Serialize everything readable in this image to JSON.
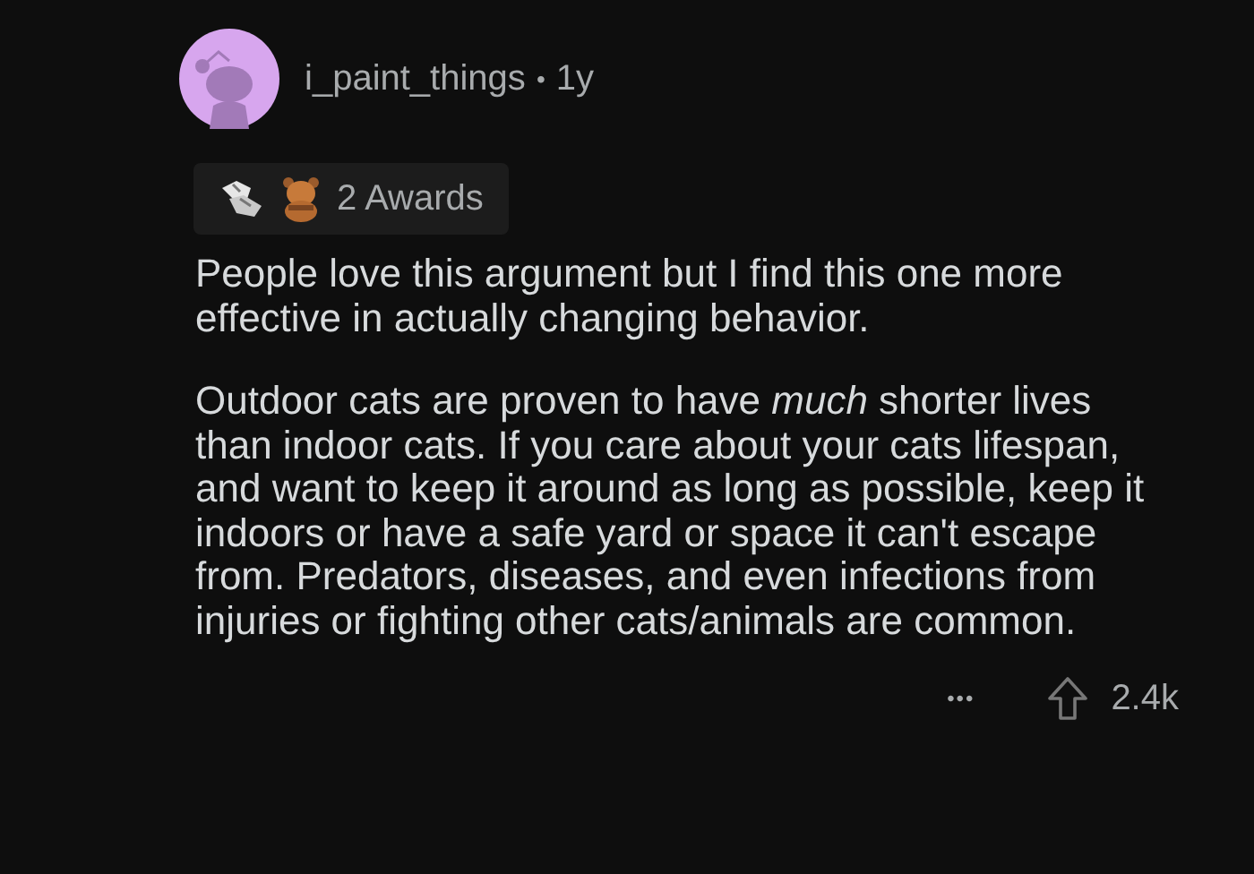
{
  "comment": {
    "author": "i_paint_things",
    "separator": "•",
    "age": "1y",
    "awards": {
      "label": "2 Awards"
    },
    "paragraphs": [
      "People love this argument but I find this one more effective in actually changing behavior.",
      "Outdoor cats are proven to have *much* shorter lives than indoor cats. If you care about your cats lifespan, and want to keep it around as long as possible, keep it indoors or have a safe yard or space it can't escape from. Predators, diseases, and even infections from injuries or fighting other cats/animals are common."
    ],
    "more": "•••",
    "score": "2.4k"
  }
}
